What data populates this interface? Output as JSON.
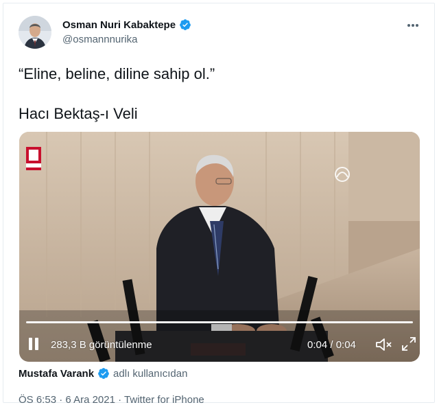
{
  "author": {
    "name": "Osman Nuri Kabaktepe",
    "handle": "@osmannnurika"
  },
  "tweet": {
    "line1": "“Eline, beline, diline sahip ol.”",
    "line2": "Hacı Bektaş-ı Veli"
  },
  "video": {
    "views": "283,3 B görüntülenme",
    "time": "0:04 / 0:04",
    "progress": 1.0
  },
  "attribution": {
    "name": "Mustafa Varank",
    "suffix": "adlı kullanıcıdan"
  },
  "meta": {
    "time": "ÖS 6:53",
    "date": "6 Ara 2021",
    "source": "Twitter for iPhone",
    "separator": "·"
  },
  "colors": {
    "verified": "#1d9bf0",
    "secondary_text": "#536471",
    "primary_text": "#0f1419"
  },
  "icons": {
    "more": "more-icon",
    "verified": "verified-badge-icon",
    "pause": "pause-icon",
    "mute": "mute-icon",
    "fullscreen": "fullscreen-icon"
  }
}
